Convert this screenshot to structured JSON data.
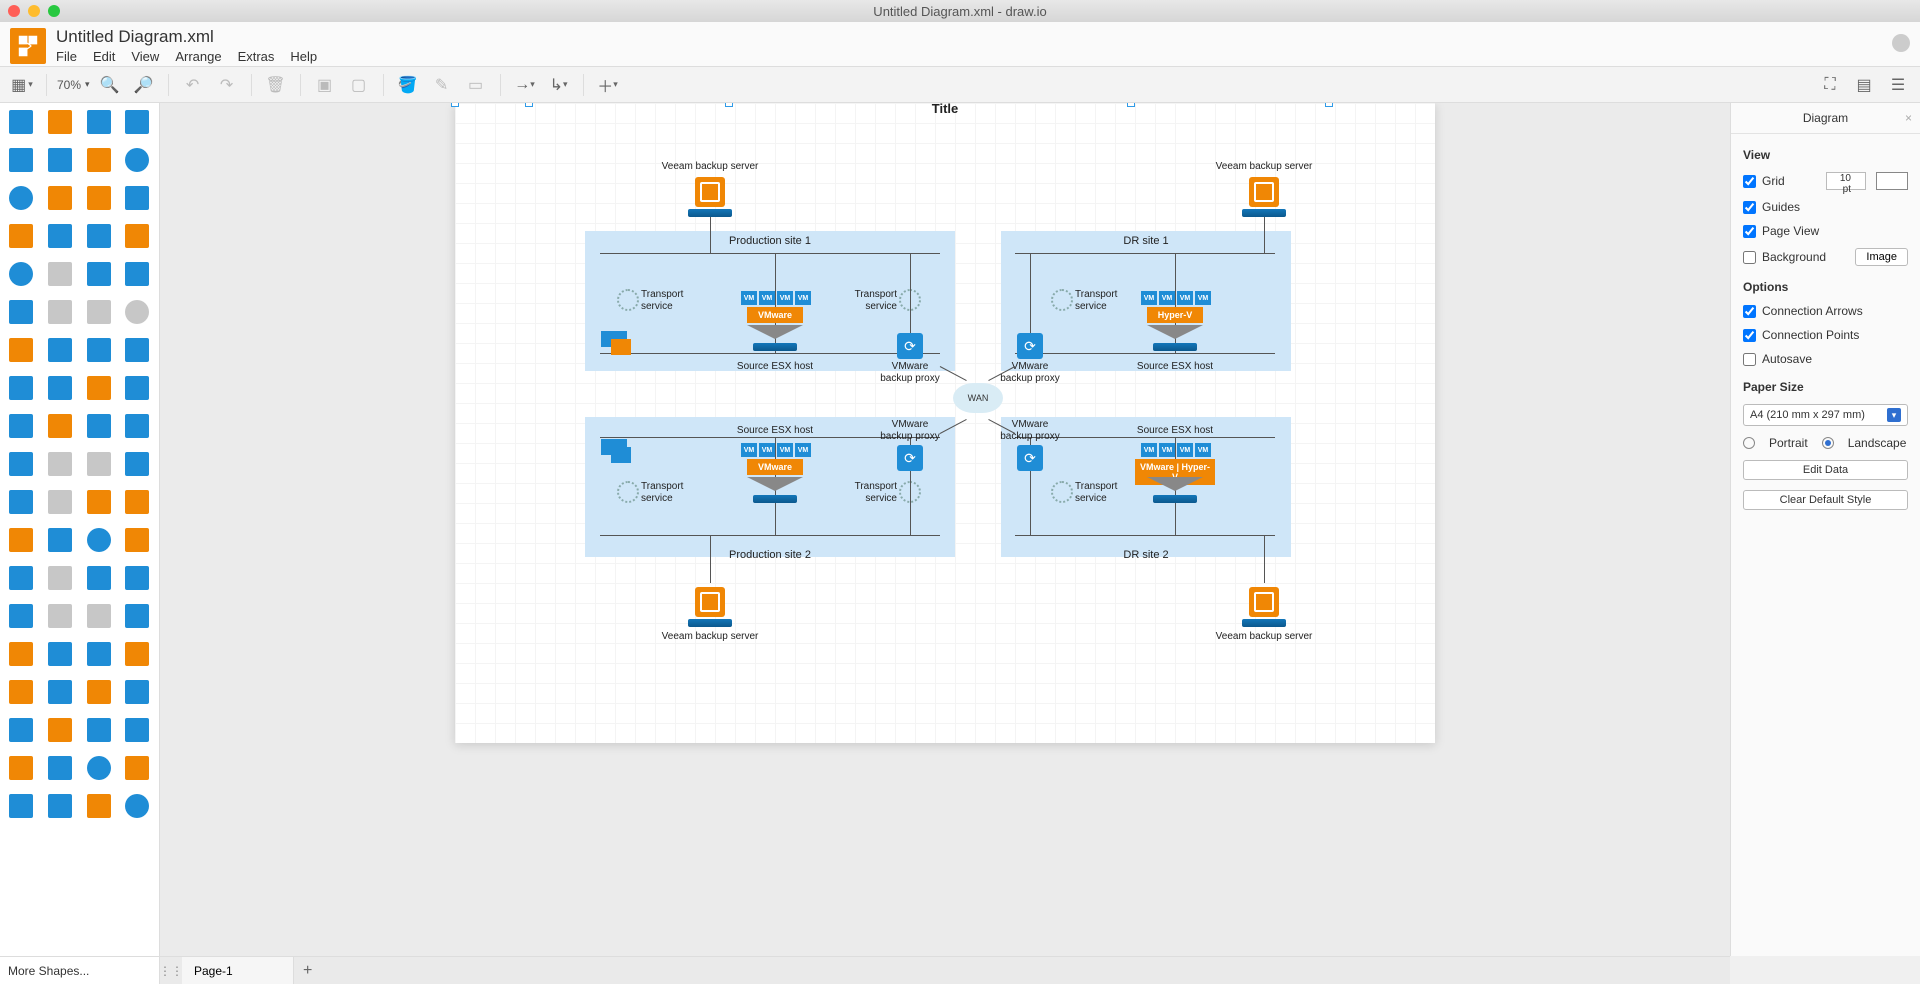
{
  "window": {
    "title": "Untitled Diagram.xml - draw.io"
  },
  "document": {
    "title": "Untitled Diagram.xml"
  },
  "menubar": [
    "File",
    "Edit",
    "View",
    "Arrange",
    "Extras",
    "Help"
  ],
  "toolbar": {
    "zoom": "70%"
  },
  "shapes_panel": {
    "more": "More Shapes..."
  },
  "footer": {
    "page1": "Page-1",
    "add": "+"
  },
  "props": {
    "title": "Diagram",
    "view": {
      "heading": "View",
      "grid": "Grid",
      "grid_checked": true,
      "grid_size": "10 pt",
      "guides": "Guides",
      "guides_checked": true,
      "pageview": "Page View",
      "pageview_checked": true,
      "background": "Background",
      "background_checked": false,
      "image_btn": "Image"
    },
    "options": {
      "heading": "Options",
      "conn_arrows": "Connection Arrows",
      "conn_arrows_checked": true,
      "conn_points": "Connection Points",
      "conn_points_checked": true,
      "autosave": "Autosave",
      "autosave_checked": false
    },
    "paper": {
      "heading": "Paper Size",
      "size": "A4 (210 mm x 297 mm)",
      "portrait": "Portrait",
      "landscape": "Landscape",
      "orientation_selected": "landscape"
    },
    "buttons": {
      "edit_data": "Edit Data",
      "clear_style": "Clear Default Style"
    }
  },
  "diagram": {
    "page_title": "Title",
    "wan": "WAN",
    "vm_label": "VM",
    "labels": {
      "veeam_server": "Veeam backup server",
      "transport_service": "Transport\nservice",
      "source_esx": "Source ESX host",
      "vmware_proxy": "VMware\nbackup proxy"
    },
    "sites": [
      {
        "id": "prod1",
        "title": "Production site 1",
        "hv": "VMware",
        "pos": "tl"
      },
      {
        "id": "dr1",
        "title": "DR site 1",
        "hv": "Hyper-V",
        "pos": "tr"
      },
      {
        "id": "prod2",
        "title": "Production site 2",
        "hv": "VMware",
        "pos": "bl"
      },
      {
        "id": "dr2",
        "title": "DR site 2",
        "hv": "VMware | Hyper-V",
        "pos": "br"
      }
    ]
  }
}
